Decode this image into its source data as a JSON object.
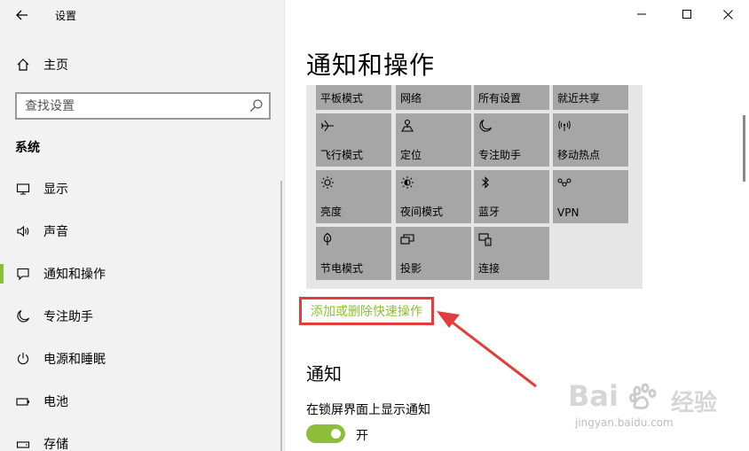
{
  "window": {
    "title": "设置",
    "minimize": "minimize",
    "maximize": "maximize",
    "close": "close"
  },
  "sidebar": {
    "home": "主页",
    "search_placeholder": "查找设置",
    "section": "系统",
    "items": [
      {
        "label": "显示",
        "icon": "monitor-icon"
      },
      {
        "label": "声音",
        "icon": "speaker-icon"
      },
      {
        "label": "通知和操作",
        "icon": "notification-icon",
        "active": true
      },
      {
        "label": "专注助手",
        "icon": "moon-icon"
      },
      {
        "label": "电源和睡眠",
        "icon": "power-icon"
      },
      {
        "label": "电池",
        "icon": "battery-icon"
      },
      {
        "label": "存储",
        "icon": "storage-icon"
      }
    ]
  },
  "main": {
    "title": "通知和操作",
    "quick_actions": [
      {
        "label": "平板模式",
        "icon": ""
      },
      {
        "label": "网络",
        "icon": ""
      },
      {
        "label": "所有设置",
        "icon": ""
      },
      {
        "label": "就近共享",
        "icon": ""
      },
      {
        "label": "飞行模式",
        "icon": "airplane-icon"
      },
      {
        "label": "定位",
        "icon": "location-icon"
      },
      {
        "label": "专注助手",
        "icon": "moon-icon"
      },
      {
        "label": "移动热点",
        "icon": "hotspot-icon"
      },
      {
        "label": "亮度",
        "icon": "brightness-icon"
      },
      {
        "label": "夜间模式",
        "icon": "night-light-icon"
      },
      {
        "label": "蓝牙",
        "icon": "bluetooth-icon"
      },
      {
        "label": "VPN",
        "icon": "vpn-icon"
      },
      {
        "label": "节电模式",
        "icon": "battery-saver-icon"
      },
      {
        "label": "投影",
        "icon": "project-icon"
      },
      {
        "label": "连接",
        "icon": "connect-icon"
      }
    ],
    "add_remove_link": "添加或删除快速操作",
    "notifications_header": "通知",
    "lock_screen_label": "在锁屏界面上显示通知",
    "toggle_state": "开"
  },
  "watermark": {
    "brand": "Bai",
    "brand_cn": "经验",
    "url": "jingyan.baidu.com"
  },
  "colors": {
    "accent": "#8cbe3a",
    "highlight_box": "#e23d3d",
    "tile": "#a6a6a6"
  }
}
